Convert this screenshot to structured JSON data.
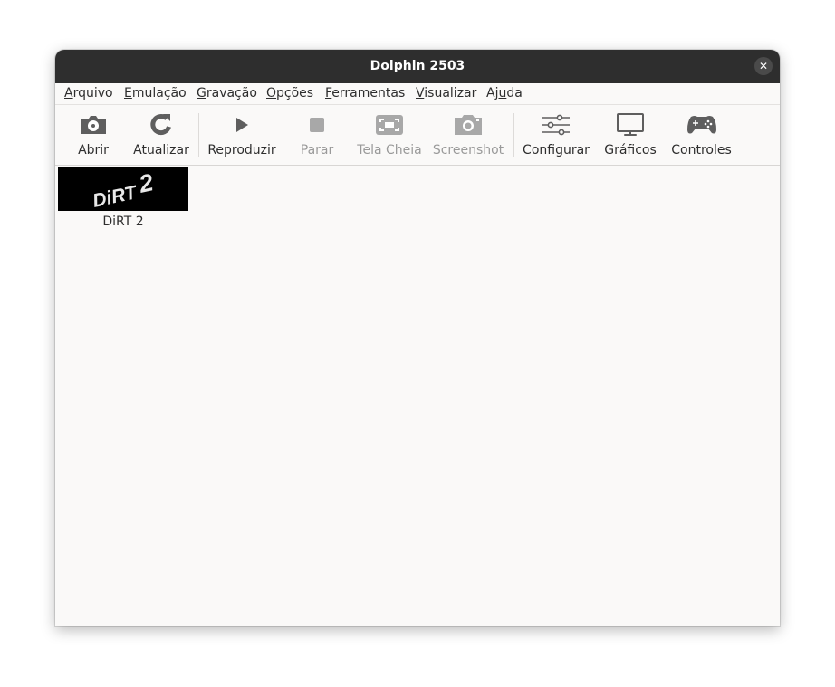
{
  "window": {
    "title": "Dolphin 2503",
    "close_glyph": "✕"
  },
  "menu": [
    {
      "mnemonic": "A",
      "rest": "rquivo"
    },
    {
      "mnemonic": "E",
      "rest": "mulação"
    },
    {
      "mnemonic": "G",
      "rest": "ravação"
    },
    {
      "mnemonic": "O",
      "rest": "pções"
    },
    {
      "mnemonic": "F",
      "rest": "erramentas"
    },
    {
      "mnemonic": "V",
      "rest": "isualizar"
    },
    {
      "pre": "Aj",
      "mnemonic": "u",
      "rest": "da"
    }
  ],
  "toolbar": [
    {
      "label": "Abrir",
      "icon": "disc-open-icon",
      "enabled": true
    },
    {
      "label": "Atualizar",
      "icon": "refresh-icon",
      "enabled": true
    },
    {
      "label": "Reproduzir",
      "icon": "play-icon",
      "enabled": true
    },
    {
      "label": "Parar",
      "icon": "stop-icon",
      "enabled": false
    },
    {
      "label": "Tela Cheia",
      "icon": "fullscreen-icon",
      "enabled": false
    },
    {
      "label": "Screenshot",
      "icon": "camera-icon",
      "enabled": false
    },
    {
      "label": "Configurar",
      "icon": "sliders-icon",
      "enabled": true
    },
    {
      "label": "Gráficos",
      "icon": "monitor-icon",
      "enabled": true
    },
    {
      "label": "Controles",
      "icon": "gamepad-icon",
      "enabled": true
    }
  ],
  "games": [
    {
      "name": "DiRT 2",
      "logo_text": "DiRT",
      "logo_number": "2"
    }
  ],
  "colors": {
    "titlebar": "#2e2e2e",
    "icon": "#5e5e5e",
    "icon_disabled": "#a8a8a8"
  }
}
